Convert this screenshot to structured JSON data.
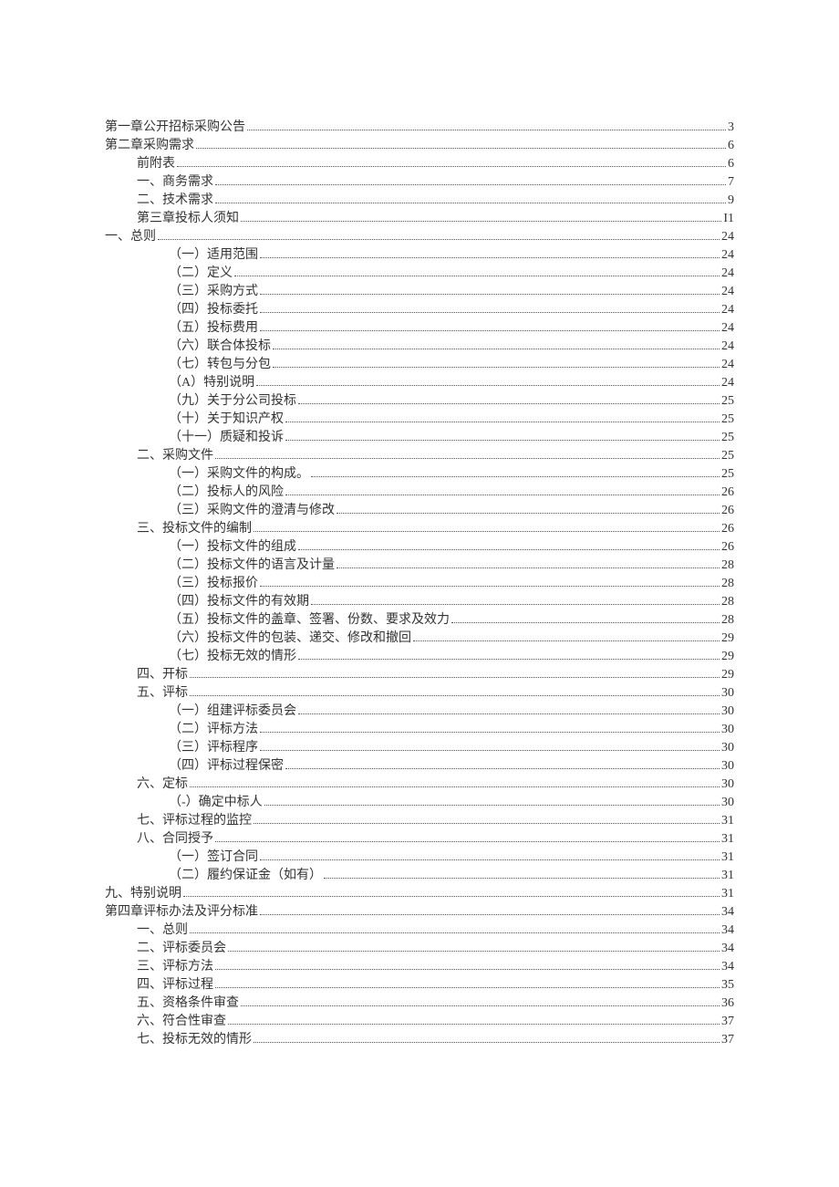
{
  "toc": [
    {
      "label": "第一章公开招标采购公告",
      "page": "3",
      "indent": "indent-0"
    },
    {
      "label": "第二章采购需求",
      "page": "6",
      "indent": "indent-0"
    },
    {
      "label": "前附表",
      "page": "6",
      "indent": "indent-1"
    },
    {
      "label": "一、商务需求",
      "page": "7",
      "indent": "indent-1"
    },
    {
      "label": "二、技术需求",
      "page": "9",
      "indent": "indent-1"
    },
    {
      "label": "第三章投标人须知",
      "page": "I1",
      "indent": "indent-1"
    },
    {
      "label": "一、总则",
      "page": "24",
      "indent": "indent-1b"
    },
    {
      "label": "（一）适用范围",
      "page": "24",
      "indent": "indent-3"
    },
    {
      "label": "（二）定义",
      "page": "24",
      "indent": "indent-3"
    },
    {
      "label": "（三）采购方式",
      "page": "24",
      "indent": "indent-3"
    },
    {
      "label": "（四）投标委托",
      "page": "24",
      "indent": "indent-3"
    },
    {
      "label": "（五）投标费用",
      "page": "24",
      "indent": "indent-3"
    },
    {
      "label": "（六）联合体投标",
      "page": "24",
      "indent": "indent-3"
    },
    {
      "label": "（七）转包与分包",
      "page": "24",
      "indent": "indent-3"
    },
    {
      "label": "（A）特别说明",
      "page": "24",
      "indent": "indent-3"
    },
    {
      "label": "（九）关于分公司投标",
      "page": "25",
      "indent": "indent-3"
    },
    {
      "label": "（十）关于知识产权",
      "page": "25",
      "indent": "indent-3"
    },
    {
      "label": "（十一）质疑和投诉",
      "page": "25",
      "indent": "indent-3"
    },
    {
      "label": "二、采购文件",
      "page": "25",
      "indent": "indent-2b"
    },
    {
      "label": "（一）采购文件的构成。",
      "page": "25",
      "indent": "indent-3"
    },
    {
      "label": "（二）投标人的风险",
      "page": "26",
      "indent": "indent-3"
    },
    {
      "label": "（三）采购文件的澄清与修改",
      "page": "26",
      "indent": "indent-3"
    },
    {
      "label": "三、投标文件的编制",
      "page": "26",
      "indent": "indent-2b"
    },
    {
      "label": "（一）投标文件的组成",
      "page": "26",
      "indent": "indent-3"
    },
    {
      "label": "（二）投标文件的语言及计量",
      "page": "28",
      "indent": "indent-3"
    },
    {
      "label": "（三）投标报价",
      "page": "28",
      "indent": "indent-3"
    },
    {
      "label": "（四）投标文件的有效期",
      "page": "28",
      "indent": "indent-3"
    },
    {
      "label": "（五）投标文件的盖章、签署、份数、要求及效力",
      "page": "28",
      "indent": "indent-3"
    },
    {
      "label": "（六）投标文件的包装、递交、修改和撤回",
      "page": "29",
      "indent": "indent-3"
    },
    {
      "label": "（七）投标无效的情形",
      "page": "29",
      "indent": "indent-3"
    },
    {
      "label": "四、开标",
      "page": "29",
      "indent": "indent-2b"
    },
    {
      "label": "五、评标",
      "page": "30",
      "indent": "indent-2b"
    },
    {
      "label": "（一）组建评标委员会",
      "page": "30",
      "indent": "indent-3"
    },
    {
      "label": "（二）评标方法",
      "page": "30",
      "indent": "indent-3"
    },
    {
      "label": "（三）评标程序",
      "page": "30",
      "indent": "indent-3"
    },
    {
      "label": "（四）评标过程保密",
      "page": "30",
      "indent": "indent-3"
    },
    {
      "label": "六、定标",
      "page": "30",
      "indent": "indent-2b"
    },
    {
      "label": "（-）确定中标人",
      "page": "30",
      "indent": "indent-3"
    },
    {
      "label": "七、评标过程的监控",
      "page": "31",
      "indent": "indent-2b"
    },
    {
      "label": "八、合同授予",
      "page": "31",
      "indent": "indent-2b"
    },
    {
      "label": "（一）签订合同",
      "page": "31",
      "indent": "indent-3"
    },
    {
      "label": "（二）履约保证金（如有）",
      "page": "31",
      "indent": "indent-3"
    },
    {
      "label": "九、特别说明",
      "page": "31",
      "indent": "indent-1b"
    },
    {
      "label": "第四章评标办法及评分标准",
      "page": "34",
      "indent": "indent-0"
    },
    {
      "label": "一、总则",
      "page": "34",
      "indent": "indent-1"
    },
    {
      "label": "二、评标委员会",
      "page": "34",
      "indent": "indent-1"
    },
    {
      "label": "三、评标方法",
      "page": "34",
      "indent": "indent-1"
    },
    {
      "label": "四、评标过程",
      "page": "35",
      "indent": "indent-1"
    },
    {
      "label": "五、资格条件审查",
      "page": "36",
      "indent": "indent-1"
    },
    {
      "label": "六、符合性审查",
      "page": "37",
      "indent": "indent-1"
    },
    {
      "label": "七、投标无效的情形",
      "page": "37",
      "indent": "indent-1"
    }
  ]
}
